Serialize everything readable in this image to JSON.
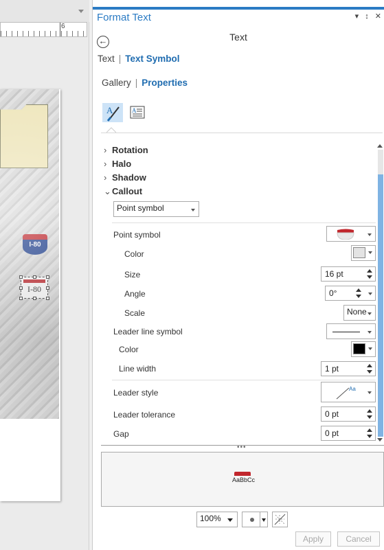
{
  "map": {
    "ruler_number": "6",
    "shield_label": "I-80",
    "selected_label": "I-80"
  },
  "pane": {
    "title": "Format Text",
    "pin": "↕",
    "close": "✕",
    "heading": "Text",
    "breadcrumb": {
      "first": "Text",
      "second": "Text Symbol"
    },
    "tabs": {
      "first": "Gallery",
      "second": "Properties"
    }
  },
  "sections": {
    "rotation": "Rotation",
    "halo": "Halo",
    "shadow": "Shadow",
    "callout": "Callout"
  },
  "callout": {
    "type_value": "Point symbol",
    "point_symbol_label": "Point symbol",
    "color_label": "Color",
    "size_label": "Size",
    "size_value": "16 pt",
    "angle_label": "Angle",
    "angle_value": "0°",
    "scale_label": "Scale",
    "scale_value": "None",
    "leader_line_label": "Leader line symbol",
    "line_color_label": "Color",
    "line_width_label": "Line width",
    "line_width_value": "1 pt",
    "leader_style_label": "Leader style",
    "leader_style_glyph": "Aa",
    "leader_tolerance_label": "Leader tolerance",
    "leader_tolerance_value": "0 pt",
    "gap_label": "Gap",
    "gap_value": "0 pt"
  },
  "colors": {
    "accent": "#2b7bc4",
    "point_color": "#e3e3e3",
    "line_color": "#000000",
    "shield_red": "#c1272d",
    "shield_blue": "#1e3f8f"
  },
  "preview": {
    "sample_text": "AaBbCc",
    "grip": "•••"
  },
  "footer": {
    "zoom": "100%",
    "apply": "Apply",
    "cancel": "Cancel"
  }
}
